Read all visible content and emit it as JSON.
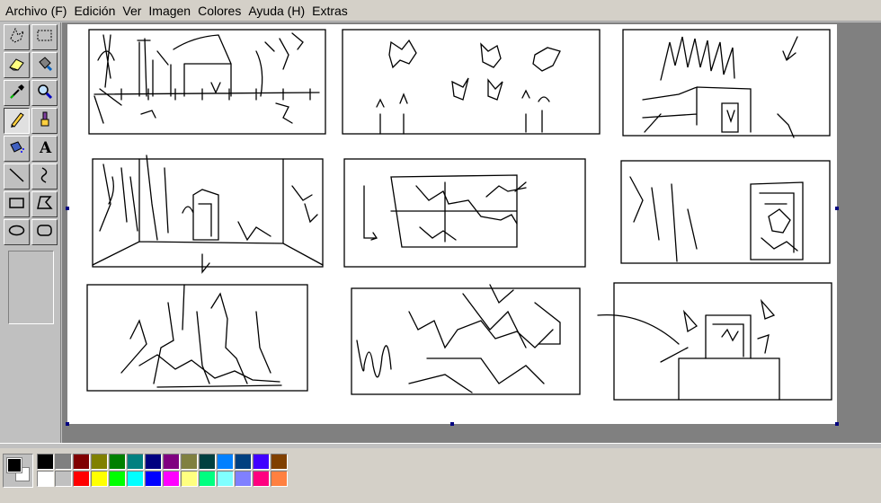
{
  "menubar": {
    "items": [
      "Archivo (F)",
      "Edición",
      "Ver",
      "Imagen",
      "Colores",
      "Ayuda (H)",
      "Extras"
    ]
  },
  "toolbox": {
    "tools": [
      {
        "name": "free-select-tool-icon",
        "active": false
      },
      {
        "name": "rect-select-tool-icon",
        "active": false
      },
      {
        "name": "eraser-tool-icon",
        "active": false
      },
      {
        "name": "fill-bucket-tool-icon",
        "active": false
      },
      {
        "name": "color-picker-tool-icon",
        "active": false
      },
      {
        "name": "magnifier-tool-icon",
        "active": false
      },
      {
        "name": "pencil-tool-icon",
        "active": true
      },
      {
        "name": "brush-tool-icon",
        "active": false
      },
      {
        "name": "airbrush-tool-icon",
        "active": false
      },
      {
        "name": "text-tool-icon",
        "active": false
      },
      {
        "name": "line-tool-icon",
        "active": false
      },
      {
        "name": "curve-tool-icon",
        "active": false
      },
      {
        "name": "rectangle-tool-icon",
        "active": false
      },
      {
        "name": "polygon-tool-icon",
        "active": false
      },
      {
        "name": "ellipse-tool-icon",
        "active": false
      },
      {
        "name": "rounded-rectangle-tool-icon",
        "active": false
      }
    ],
    "text_tool_glyph": "A"
  },
  "colors": {
    "foreground": "#000000",
    "background": "#ffffff",
    "palette_top": [
      "#000000",
      "#808080",
      "#800000",
      "#808000",
      "#008000",
      "#008080",
      "#000080",
      "#800080",
      "#808040",
      "#004040",
      "#0080ff",
      "#004080",
      "#4000ff",
      "#804000"
    ],
    "palette_bottom": [
      "#ffffff",
      "#c0c0c0",
      "#ff0000",
      "#ffff00",
      "#00ff00",
      "#00ffff",
      "#0000ff",
      "#ff00ff",
      "#ffff80",
      "#00ff80",
      "#80ffff",
      "#8080ff",
      "#ff0080",
      "#ff8040"
    ]
  }
}
